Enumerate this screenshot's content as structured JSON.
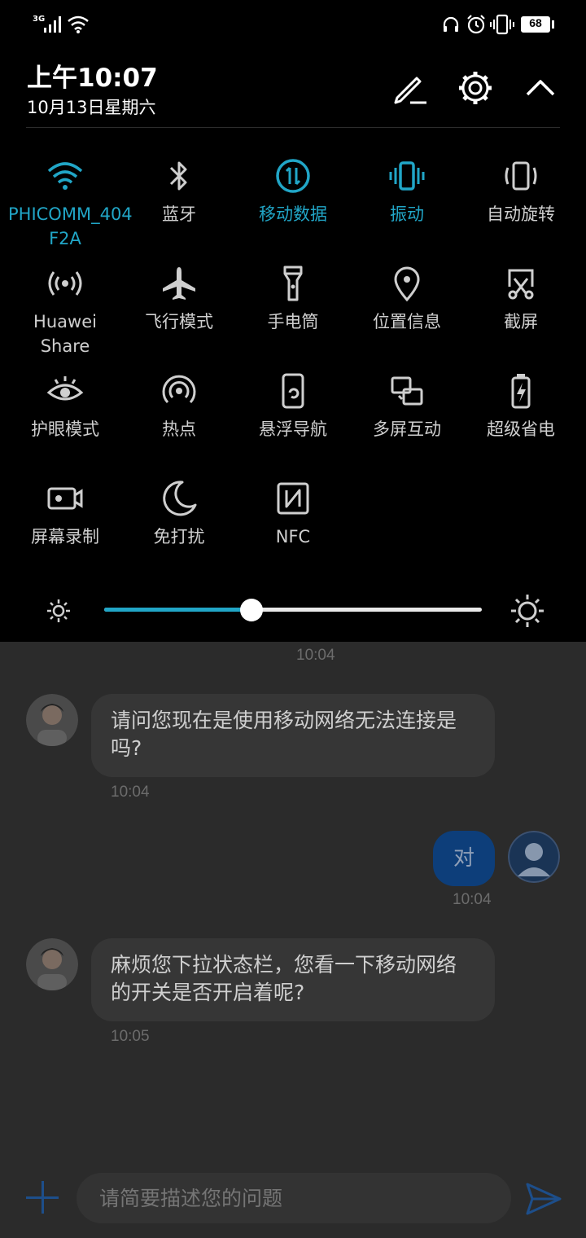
{
  "status_bar": {
    "network": "3G",
    "battery": "68"
  },
  "shade": {
    "time": "上午10:07",
    "date": "10月13日星期六",
    "tiles": [
      {
        "label": "PHICOMM_404\nF2A",
        "icon": "wifi-icon",
        "active": true
      },
      {
        "label": "蓝牙",
        "icon": "bluetooth-icon",
        "active": false
      },
      {
        "label": "移动数据",
        "icon": "mobile-data-icon",
        "active": true
      },
      {
        "label": "振动",
        "icon": "vibrate-icon",
        "active": true
      },
      {
        "label": "自动旋转",
        "icon": "auto-rotate-icon",
        "active": false
      },
      {
        "label": "Huawei Share",
        "icon": "huawei-share-icon",
        "active": false
      },
      {
        "label": "飞行模式",
        "icon": "airplane-icon",
        "active": false
      },
      {
        "label": "手电筒",
        "icon": "flashlight-icon",
        "active": false
      },
      {
        "label": "位置信息",
        "icon": "location-icon",
        "active": false
      },
      {
        "label": "截屏",
        "icon": "screenshot-icon",
        "active": false
      },
      {
        "label": "护眼模式",
        "icon": "eye-comfort-icon",
        "active": false
      },
      {
        "label": "热点",
        "icon": "hotspot-icon",
        "active": false
      },
      {
        "label": "悬浮导航",
        "icon": "floating-nav-icon",
        "active": false
      },
      {
        "label": "多屏互动",
        "icon": "multi-screen-icon",
        "active": false
      },
      {
        "label": "超级省电",
        "icon": "ultra-power-saving-icon",
        "active": false
      },
      {
        "label": "屏幕录制",
        "icon": "screen-record-icon",
        "active": false
      },
      {
        "label": "免打扰",
        "icon": "do-not-disturb-icon",
        "active": false
      },
      {
        "label": "NFC",
        "icon": "nfc-icon",
        "active": false
      }
    ],
    "brightness_fraction": 0.39
  },
  "chat": {
    "messages": [
      {
        "time_above": "10:04"
      },
      {
        "from": "agent",
        "text": "请问您现在是使用移动网络无法连接是吗?",
        "time": "10:04"
      },
      {
        "from": "me",
        "text": "对",
        "time": "10:04"
      },
      {
        "from": "agent",
        "text": "麻烦您下拉状态栏，您看一下移动网络的开关是否开启着呢?",
        "time": "10:05"
      }
    ],
    "input_placeholder": "请简要描述您的问题"
  },
  "colors": {
    "accent": "#21a6c7",
    "shade_bg": "#000000"
  }
}
